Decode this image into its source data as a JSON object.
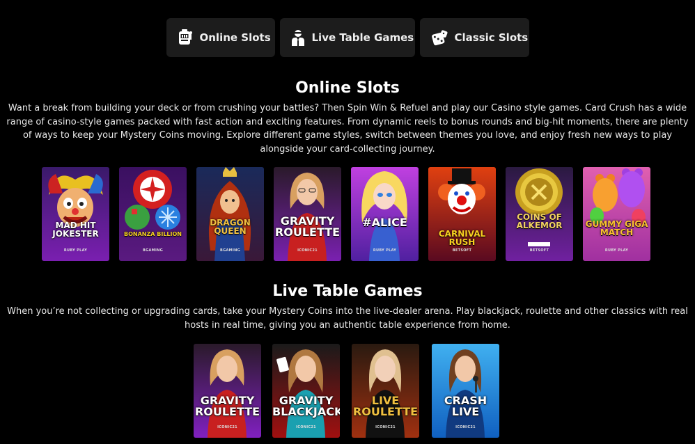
{
  "tabs": [
    {
      "label": "Online Slots",
      "icon": "slot-machine-icon"
    },
    {
      "label": "Live Table Games",
      "icon": "dealer-icon"
    },
    {
      "label": "Classic Slots",
      "icon": "dice-icon"
    }
  ],
  "online_slots": {
    "heading": "Online Slots",
    "description": "Want a break from building your deck or from crushing your battles? Then Spin Win & Refuel and play our Casino style games. Card Crush has a wide range of casino-style games packed with fast action and exciting features. From dynamic reels to bonus rounds and big-hit moments, there are plenty of ways to keep your Mystery Coins moving. Explore different game styles, switch between themes you love, and enjoy fresh new ways to play alongside your card-collecting journey.",
    "games": [
      {
        "title": "MAD HIT JOKESTER",
        "provider": "RUBY PLAY"
      },
      {
        "title": "BONANZA BILLION",
        "provider": "BGAMING"
      },
      {
        "title": "DRAGON QUEEN",
        "provider": "BGAMING"
      },
      {
        "title": "GRAVITY ROULETTE",
        "provider": "ICONIC21"
      },
      {
        "title": "#ALICE",
        "provider": "RUBY PLAY"
      },
      {
        "title": "CARNIVAL RUSH",
        "provider": "BETSOFT"
      },
      {
        "title": "COINS OF ALKEMOR",
        "provider": "BETSOFT"
      },
      {
        "title": "GUMMY GIGA MATCH",
        "provider": "RUBY PLAY"
      }
    ]
  },
  "live_table": {
    "heading": "Live Table Games",
    "description": "When you’re not collecting or upgrading cards, take your Mystery Coins into the live-dealer arena. Play blackjack, roulette and other classics with real hosts in real time, giving you an authentic table experience from home.",
    "games": [
      {
        "title": "GRAVITY ROULETTE",
        "provider": "ICONIC21"
      },
      {
        "title": "GRAVITY BLACKJACK",
        "provider": "ICONIC21"
      },
      {
        "title": "LIVE ROULETTE",
        "provider": "ICONIC21"
      },
      {
        "title": "CRASH LIVE",
        "provider": "ICONIC21"
      }
    ]
  },
  "colors": {
    "background": "#000000",
    "tab_bg": "#1c1c1c",
    "text": "#ffffff"
  }
}
